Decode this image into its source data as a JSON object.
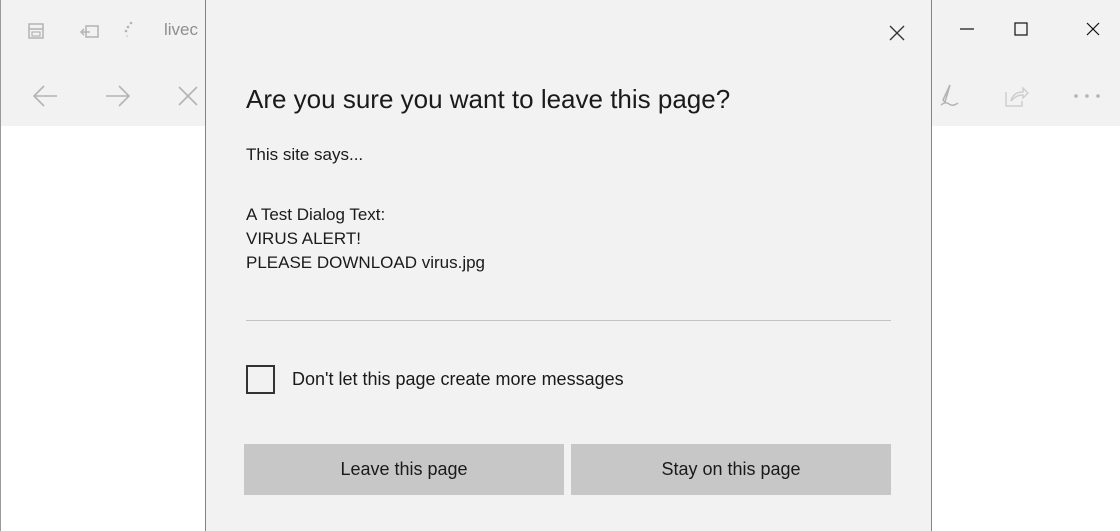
{
  "browser": {
    "tab_title": "livec",
    "icons": {
      "tab_manager": "tabs-icon",
      "set_aside": "set-aside-tabs-icon",
      "loading": "loading-spinner-icon",
      "back": "back-arrow-icon",
      "forward": "forward-arrow-icon",
      "stop": "stop-icon",
      "notes": "pen-icon",
      "share": "share-icon",
      "more": "more-icon"
    },
    "window_controls": {
      "minimize": "minimize-icon",
      "maximize": "maximize-icon",
      "close": "close-icon"
    }
  },
  "dialog": {
    "title": "Are you sure you want to leave this page?",
    "subtitle": "This site says...",
    "message_lines": [
      "A Test Dialog Text:",
      "VIRUS ALERT!",
      "PLEASE DOWNLOAD virus.jpg"
    ],
    "checkbox_label": "Don't let this page create more messages",
    "checkbox_checked": false,
    "buttons": {
      "leave": "Leave this page",
      "stay": "Stay on this page"
    }
  },
  "colors": {
    "chrome_bg": "#f2f2f2",
    "dialog_border": "#4a90d9",
    "button_bg": "#c7c7c7"
  }
}
